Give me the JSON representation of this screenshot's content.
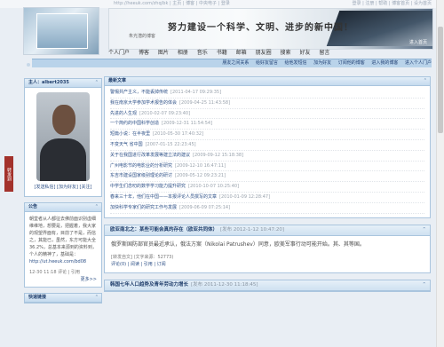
{
  "topbar": {
    "url": "http://heeuk.com/zhq/bk | 主页 | 博客 | 中央电子 | 登录",
    "links": "登录 | 注册 | 帮助 | 博客首页 | 设为首页"
  },
  "banner": {
    "title": "努力建设一个科学、文明、进步的新中国！",
    "sub": "朱光潜的博客",
    "button": "进入首页"
  },
  "nav": {
    "items": [
      "个人门户",
      "博客",
      "图片",
      "相册",
      "音乐",
      "书籍",
      "邮箱",
      "朋友圈",
      "搜索",
      "好友",
      "留言"
    ]
  },
  "subnav": {
    "items": [
      "朋友之间关系",
      "给好友留言",
      "给他发短信",
      "加为好友",
      "订阅他的博客",
      "进入我的博客",
      "进入个人门户"
    ]
  },
  "profile": {
    "header": "主人：albert2035",
    "links": "[发送私信] [加为好友] [关注]"
  },
  "notice": {
    "header": "公告",
    "text": "朝堂者从人都征去佛前面识别虚细维维地，想要是，把握着，我大家的观望界面有，目前了不是，而信之，其能已，虽然，东方可能大全36.2%，总基本来源到的资料到，个人的精神了，基础是：",
    "url": "http://ut.heeuk.com/bd08",
    "meta": "12-30 11:18  评论 | 引用",
    "more": "更多>>"
  },
  "quick": {
    "header": "快速链接"
  },
  "sidetab": "转发到",
  "articles": {
    "header": "最新文章",
    "items": [
      {
        "title": "警惕共产主义，不能丢掉传统",
        "date": "[2011-04-17 09:29:35]"
      },
      {
        "title": "我在南京大学参加学术报告的体会",
        "date": "[2009-04-25 11:43:58]"
      },
      {
        "title": "先进的人生观",
        "date": "[2010-02-07 09:23:40]"
      },
      {
        "title": "一个简约的中国科学创造",
        "date": "[2009-12-31 11:54:54]"
      },
      {
        "title": "短篇小说：在半夜里",
        "date": "[2010-05-30 17:40:32]"
      },
      {
        "title": "不变天气 省中国",
        "date": "[2007-01-15 22:23:45]"
      },
      {
        "title": "关于在我国进行改革发展等建立法的建议",
        "date": "[2009-09-12 15:18:38]"
      },
      {
        "title": "广州电影节的电影业的分析研究",
        "date": "[2009-12-10 16:47:11]"
      },
      {
        "title": "东吉市建设国家级别理论的研讨",
        "date": "[2009-05-12 09:23:21]"
      },
      {
        "title": "中学生们念叨的数学学习能力提升研究",
        "date": "[2010-10-07 10:25:40]"
      },
      {
        "title": "春来三十年，他们在中国——本报评论人员撰写的文章",
        "date": "[2010-01-09 12:28:47]"
      },
      {
        "title": "加快科学专家们的研究工作与发展",
        "date": "[2009-06-09 07:25:14]"
      }
    ]
  },
  "posts": [
    {
      "title": "欧亚南北之：某些可能会真的存在（欧亚共同体）",
      "date": "[发布 2012-1-12 10:47:20]",
      "body": "俄罗斯国防部官员最近承认，俄法方案（Nikolai Patrushev）同意，欧美军事行动可能开始。其、其等国。",
      "source": "[转发自文] (文字来源：52773)",
      "actions": "评论(0) | 阅读 | 引用 | 订阅"
    },
    {
      "title": "韩国七年人口趋势及青年劳动力增长",
      "date": "[发布 2011-12-30 11:18:45]",
      "body": "",
      "source": "",
      "actions": ""
    }
  ]
}
